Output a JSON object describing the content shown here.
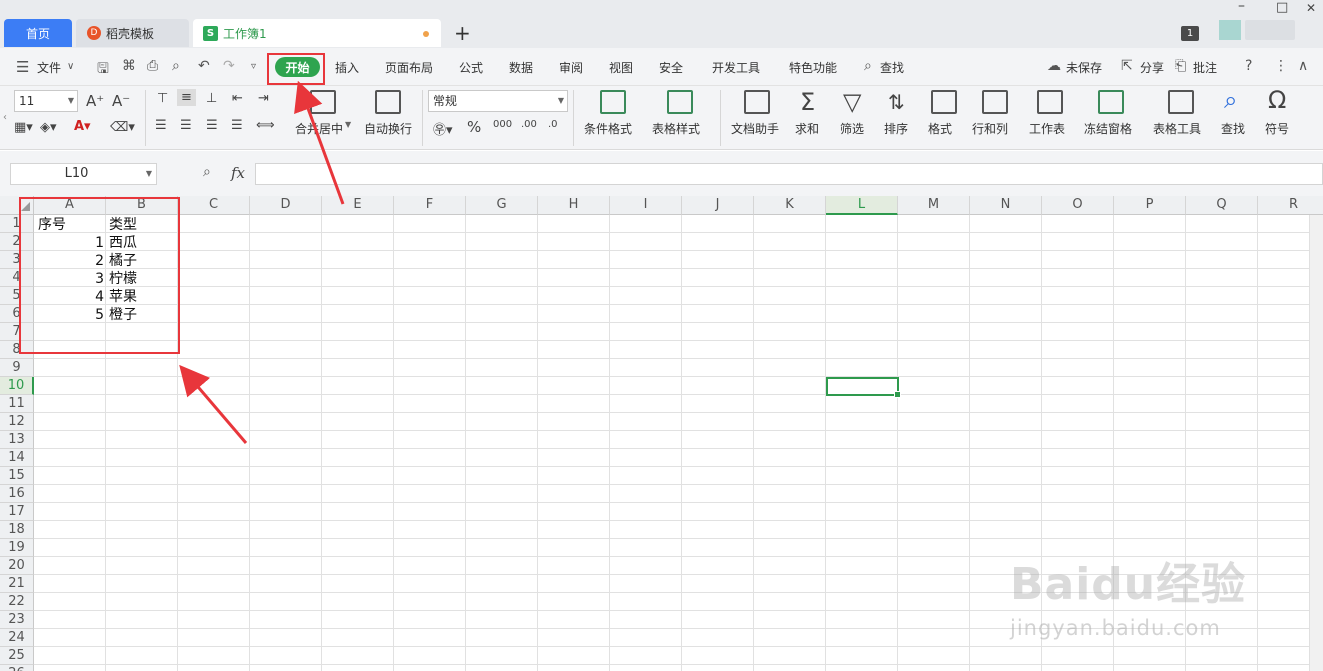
{
  "tabs": {
    "home": "首页",
    "template": "稻壳模板",
    "workbook": "工作簿1",
    "template_logo": "D",
    "workbook_logo": "S",
    "new_tab": "+",
    "window_count": "1"
  },
  "window_controls": {
    "minimize": "–",
    "maximize": "□",
    "close": "✕"
  },
  "menu": {
    "file": "文件",
    "start": "开始",
    "insert": "插入",
    "page_layout": "页面布局",
    "formula": "公式",
    "data": "数据",
    "review": "审阅",
    "view": "视图",
    "security": "安全",
    "developer": "开发工具",
    "special": "特色功能",
    "search": "查找",
    "unsaved": "未保存",
    "share": "分享",
    "comment": "批注"
  },
  "ribbon": {
    "font_size": "11",
    "number_format": "常规",
    "merge_center": "合并居中",
    "wrap_text": "自动换行",
    "conditional_format": "条件格式",
    "table_style": "表格样式",
    "doc_assistant": "文档助手",
    "sum": "求和",
    "filter": "筛选",
    "sort": "排序",
    "format": "格式",
    "row_col": "行和列",
    "worksheet": "工作表",
    "freeze": "冻结窗格",
    "table_tools": "表格工具",
    "find": "查找",
    "symbol": "符号"
  },
  "formula_bar": {
    "name_box": "L10",
    "fx": "fx",
    "value": ""
  },
  "sheet": {
    "columns": [
      "A",
      "B",
      "C",
      "D",
      "E",
      "F",
      "G",
      "H",
      "I",
      "J",
      "K",
      "L",
      "M",
      "N",
      "O",
      "P",
      "Q",
      "R"
    ],
    "selected_column": "L",
    "selected_row": "10",
    "rows": [
      "1",
      "2",
      "3",
      "4",
      "5",
      "6",
      "7",
      "8",
      "9",
      "10",
      "11",
      "12",
      "13",
      "14",
      "15",
      "16",
      "17",
      "18",
      "19",
      "20",
      "21",
      "22",
      "23",
      "24",
      "25",
      "26"
    ],
    "cells": {
      "A1": "序号",
      "B1": "类型",
      "A2": "1",
      "B2": "西瓜",
      "A3": "2",
      "B3": "橘子",
      "A4": "3",
      "B4": "柠檬",
      "A5": "4",
      "B5": "苹果",
      "A6": "5",
      "B6": "橙子"
    }
  },
  "watermark": {
    "brand": "Baidu经验",
    "url": "jingyan.baidu.com"
  },
  "colors": {
    "accent_green": "#2ea44f",
    "home_tab_blue": "#3c7df5",
    "annotation_red": "#e8363b"
  }
}
